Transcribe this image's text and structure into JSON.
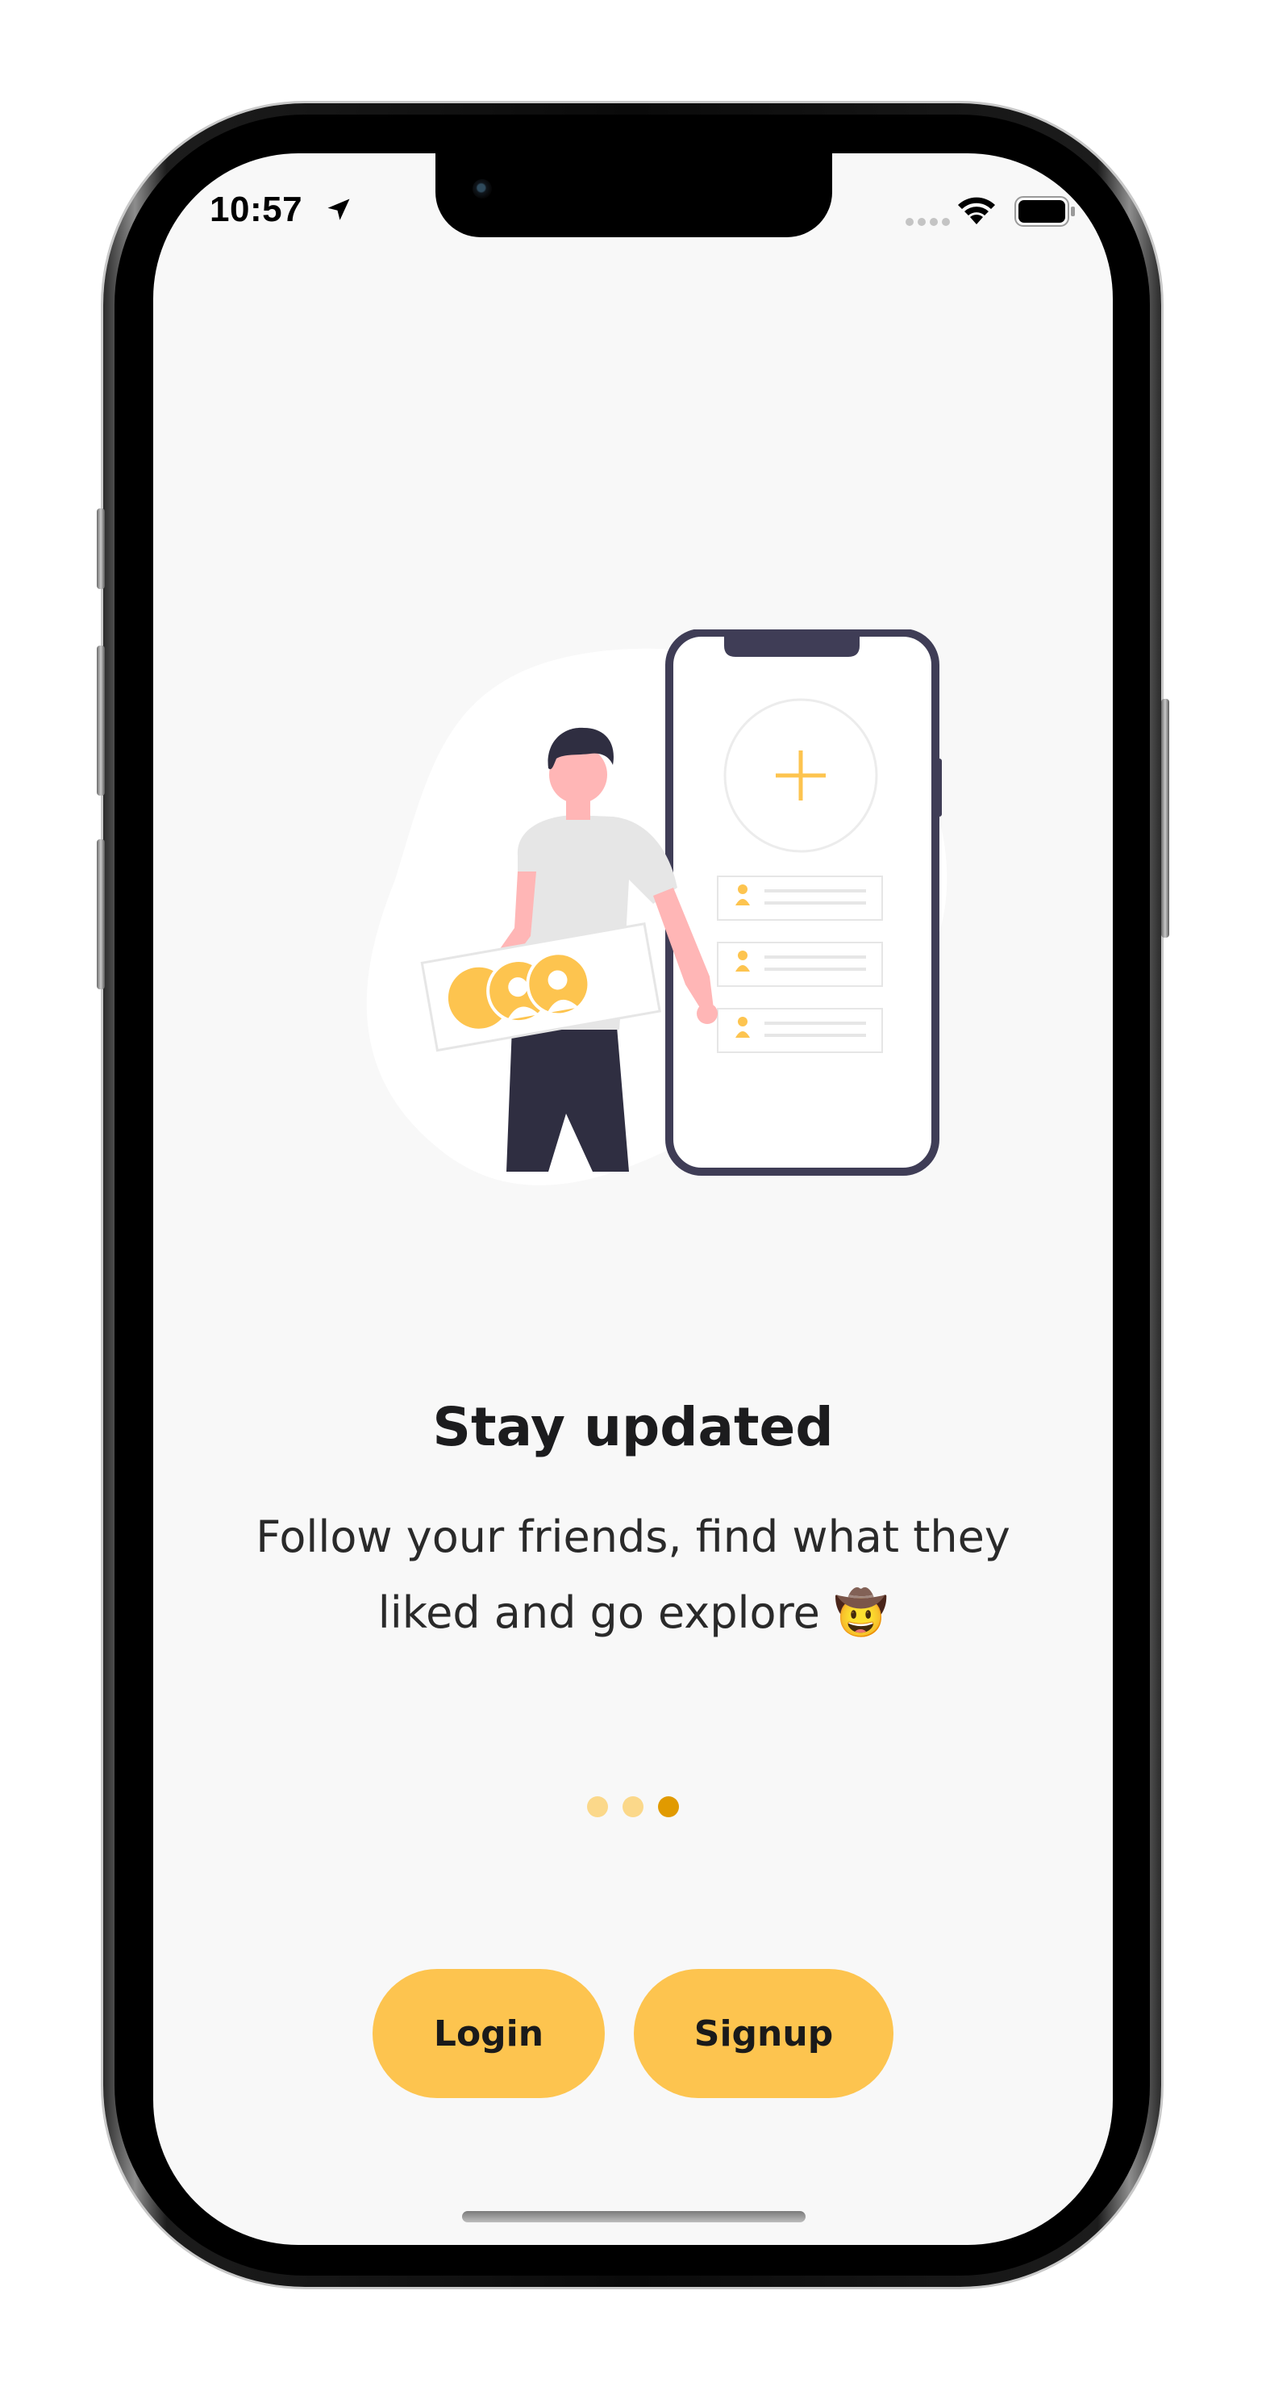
{
  "status_bar": {
    "time": "10:57",
    "location_icon": "location-arrow-icon",
    "signal_icon": "cellular-signal-icon",
    "wifi_icon": "wifi-icon",
    "battery_icon": "battery-icon"
  },
  "onboarding": {
    "illustration": "person-with-phone-illustration",
    "title": "Stay updated",
    "subtitle": "Follow your friends, find what they liked and go explore 🤠",
    "pager": {
      "total": 3,
      "active_index": 2
    }
  },
  "actions": {
    "login_label": "Login",
    "signup_label": "Signup"
  },
  "colors": {
    "accent": "#fdc44f",
    "dot_inactive": "#fbd88a",
    "dot_active": "#e19a00",
    "background": "#f8f8f8",
    "text": "#1c1c1e",
    "phone_outline": "#3f3d56"
  }
}
